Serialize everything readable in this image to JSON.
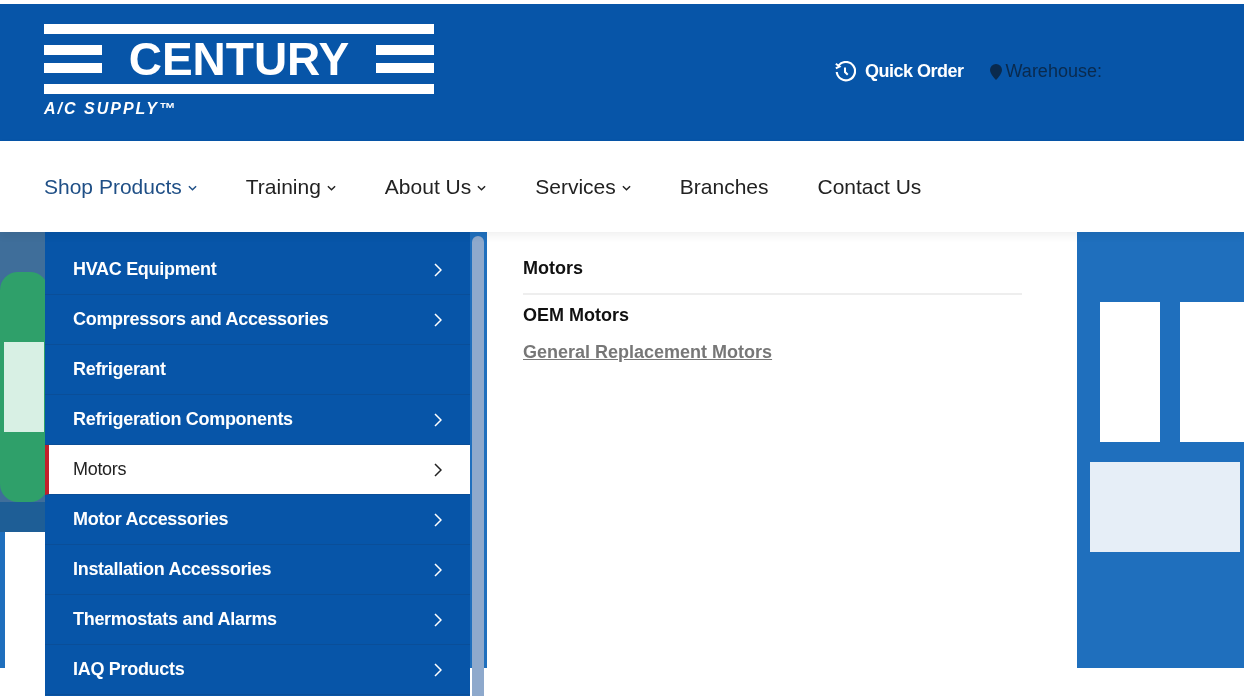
{
  "header": {
    "logo": {
      "name": "CENTURY",
      "tagline": "A/C SUPPLY™"
    },
    "quick_order": "Quick Order",
    "warehouse": {
      "label": "Warehouse:",
      "disabled": true
    }
  },
  "nav": [
    {
      "label": "Shop Products",
      "has_dropdown": true,
      "selected": true
    },
    {
      "label": "Training",
      "has_dropdown": true,
      "selected": false
    },
    {
      "label": "About Us",
      "has_dropdown": true,
      "selected": false
    },
    {
      "label": "Services",
      "has_dropdown": true,
      "selected": false
    },
    {
      "label": "Branches",
      "has_dropdown": false,
      "selected": false
    },
    {
      "label": "Contact Us",
      "has_dropdown": false,
      "selected": false
    }
  ],
  "categories": [
    {
      "label": "HVAC Equipment",
      "has_submenu": true,
      "selected": false
    },
    {
      "label": "Compressors and Accessories",
      "has_submenu": true,
      "selected": false
    },
    {
      "label": "Refrigerant",
      "has_submenu": false,
      "selected": false
    },
    {
      "label": "Refrigeration Components",
      "has_submenu": true,
      "selected": false
    },
    {
      "label": "Motors",
      "has_submenu": true,
      "selected": true
    },
    {
      "label": "Motor Accessories",
      "has_submenu": true,
      "selected": false
    },
    {
      "label": "Installation Accessories",
      "has_submenu": true,
      "selected": false
    },
    {
      "label": "Thermostats and Alarms",
      "has_submenu": true,
      "selected": false
    },
    {
      "label": "IAQ Products",
      "has_submenu": true,
      "selected": false
    }
  ],
  "submenu": {
    "title": "Motors",
    "links": [
      {
        "label": "OEM Motors",
        "kind": "heading"
      },
      {
        "label": "General Replacement Motors",
        "kind": "link"
      }
    ]
  }
}
